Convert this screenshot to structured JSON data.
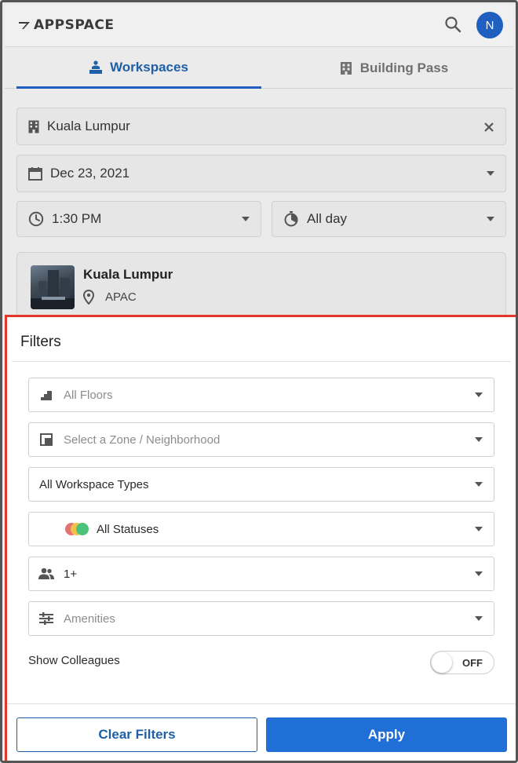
{
  "app": {
    "brand": "APPSPACE",
    "avatar_initial": "N"
  },
  "tabs": [
    {
      "label": "Workspaces",
      "icon": "person-desk-icon",
      "active": true
    },
    {
      "label": "Building Pass",
      "icon": "building-icon",
      "active": false
    }
  ],
  "search": {
    "location": "Kuala Lumpur",
    "date": "Dec 23, 2021",
    "time": "1:30 PM",
    "duration": "All day"
  },
  "location_card": {
    "title": "Kuala Lumpur",
    "region": "APAC"
  },
  "filters": {
    "title": "Filters",
    "floors_placeholder": "All Floors",
    "zone_placeholder": "Select a Zone / Neighborhood",
    "workspace_types": "All Workspace Types",
    "statuses": "All Statuses",
    "capacity": "1+",
    "amenities_placeholder": "Amenities",
    "show_colleagues_label": "Show Colleagues",
    "show_colleagues_state": "OFF",
    "clear_label": "Clear Filters",
    "apply_label": "Apply"
  },
  "colors": {
    "accent": "#1f5fbf",
    "apply": "#1f6fd6",
    "highlight_border": "#e0392b",
    "status_red": "#e57373",
    "status_yellow": "#f2c14e",
    "status_green": "#4cc27a"
  }
}
